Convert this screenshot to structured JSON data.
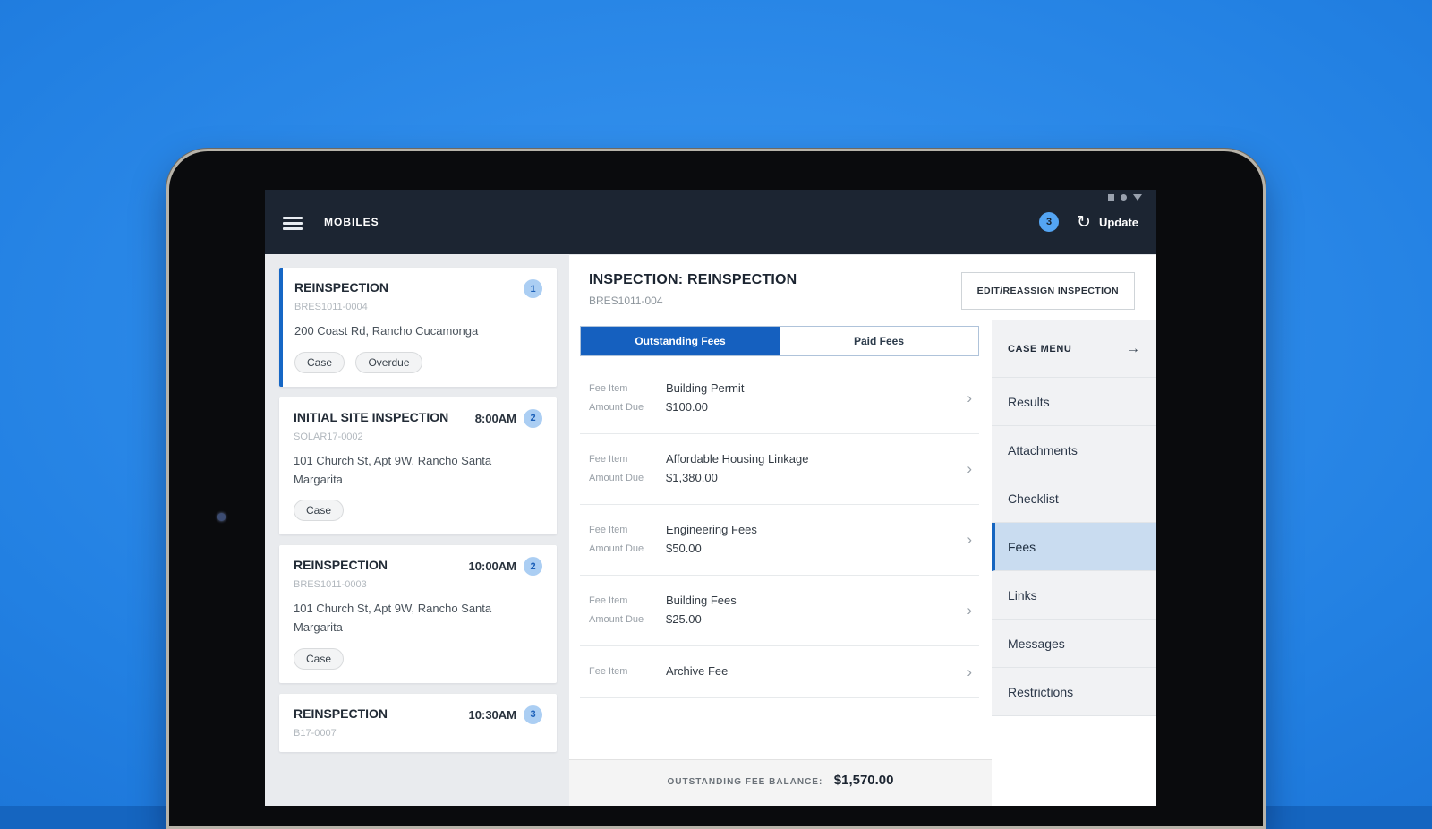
{
  "icons": {
    "refresh": "↻",
    "chevron": "›",
    "arrow": "→"
  },
  "app_bar": {
    "title": "MOBILES",
    "badge_count": "3",
    "update_label": "Update"
  },
  "inspection_list": {
    "cards": [
      {
        "title": "REINSPECTION",
        "time": "",
        "badge": "1",
        "code": "BRES1011-0004",
        "address": "200 Coast Rd, Rancho Cucamonga",
        "tags": [
          "Case",
          "Overdue"
        ]
      },
      {
        "title": "INITIAL SITE INSPECTION",
        "time": "8:00AM",
        "badge": "2",
        "code": "SOLAR17-0002",
        "address": "101 Church St, Apt 9W, Rancho Santa Margarita",
        "tags": [
          "Case"
        ]
      },
      {
        "title": "REINSPECTION",
        "time": "10:00AM",
        "badge": "2",
        "code": "BRES1011-0003",
        "address": "101 Church St, Apt 9W, Rancho Santa Margarita",
        "tags": [
          "Case"
        ]
      },
      {
        "title": "REINSPECTION",
        "time": "10:30AM",
        "badge": "3",
        "code": "B17-0007",
        "address": "",
        "tags": []
      }
    ]
  },
  "detail": {
    "title": "INSPECTION: REINSPECTION",
    "code": "BRES1011-004",
    "edit_button_label": "EDIT/REASSIGN INSPECTION",
    "tabs": {
      "outstanding": "Outstanding Fees",
      "paid": "Paid Fees"
    },
    "fee_item_label": "Fee Item",
    "amount_due_label": "Amount Due",
    "fees": [
      {
        "name": "Building Permit",
        "amount": "$100.00"
      },
      {
        "name": "Affordable Housing Linkage",
        "amount": "$1,380.00"
      },
      {
        "name": "Engineering Fees",
        "amount": "$50.00"
      },
      {
        "name": "Building Fees",
        "amount": "$25.00"
      },
      {
        "name": "Archive Fee",
        "amount": ""
      }
    ],
    "balance_label": "OUTSTANDING FEE BALANCE:",
    "balance_value": "$1,570.00"
  },
  "case_menu": {
    "title": "CASE MENU",
    "items": [
      "Results",
      "Attachments",
      "Checklist",
      "Fees",
      "Links",
      "Messages",
      "Restrictions"
    ],
    "active_item": "Fees"
  }
}
